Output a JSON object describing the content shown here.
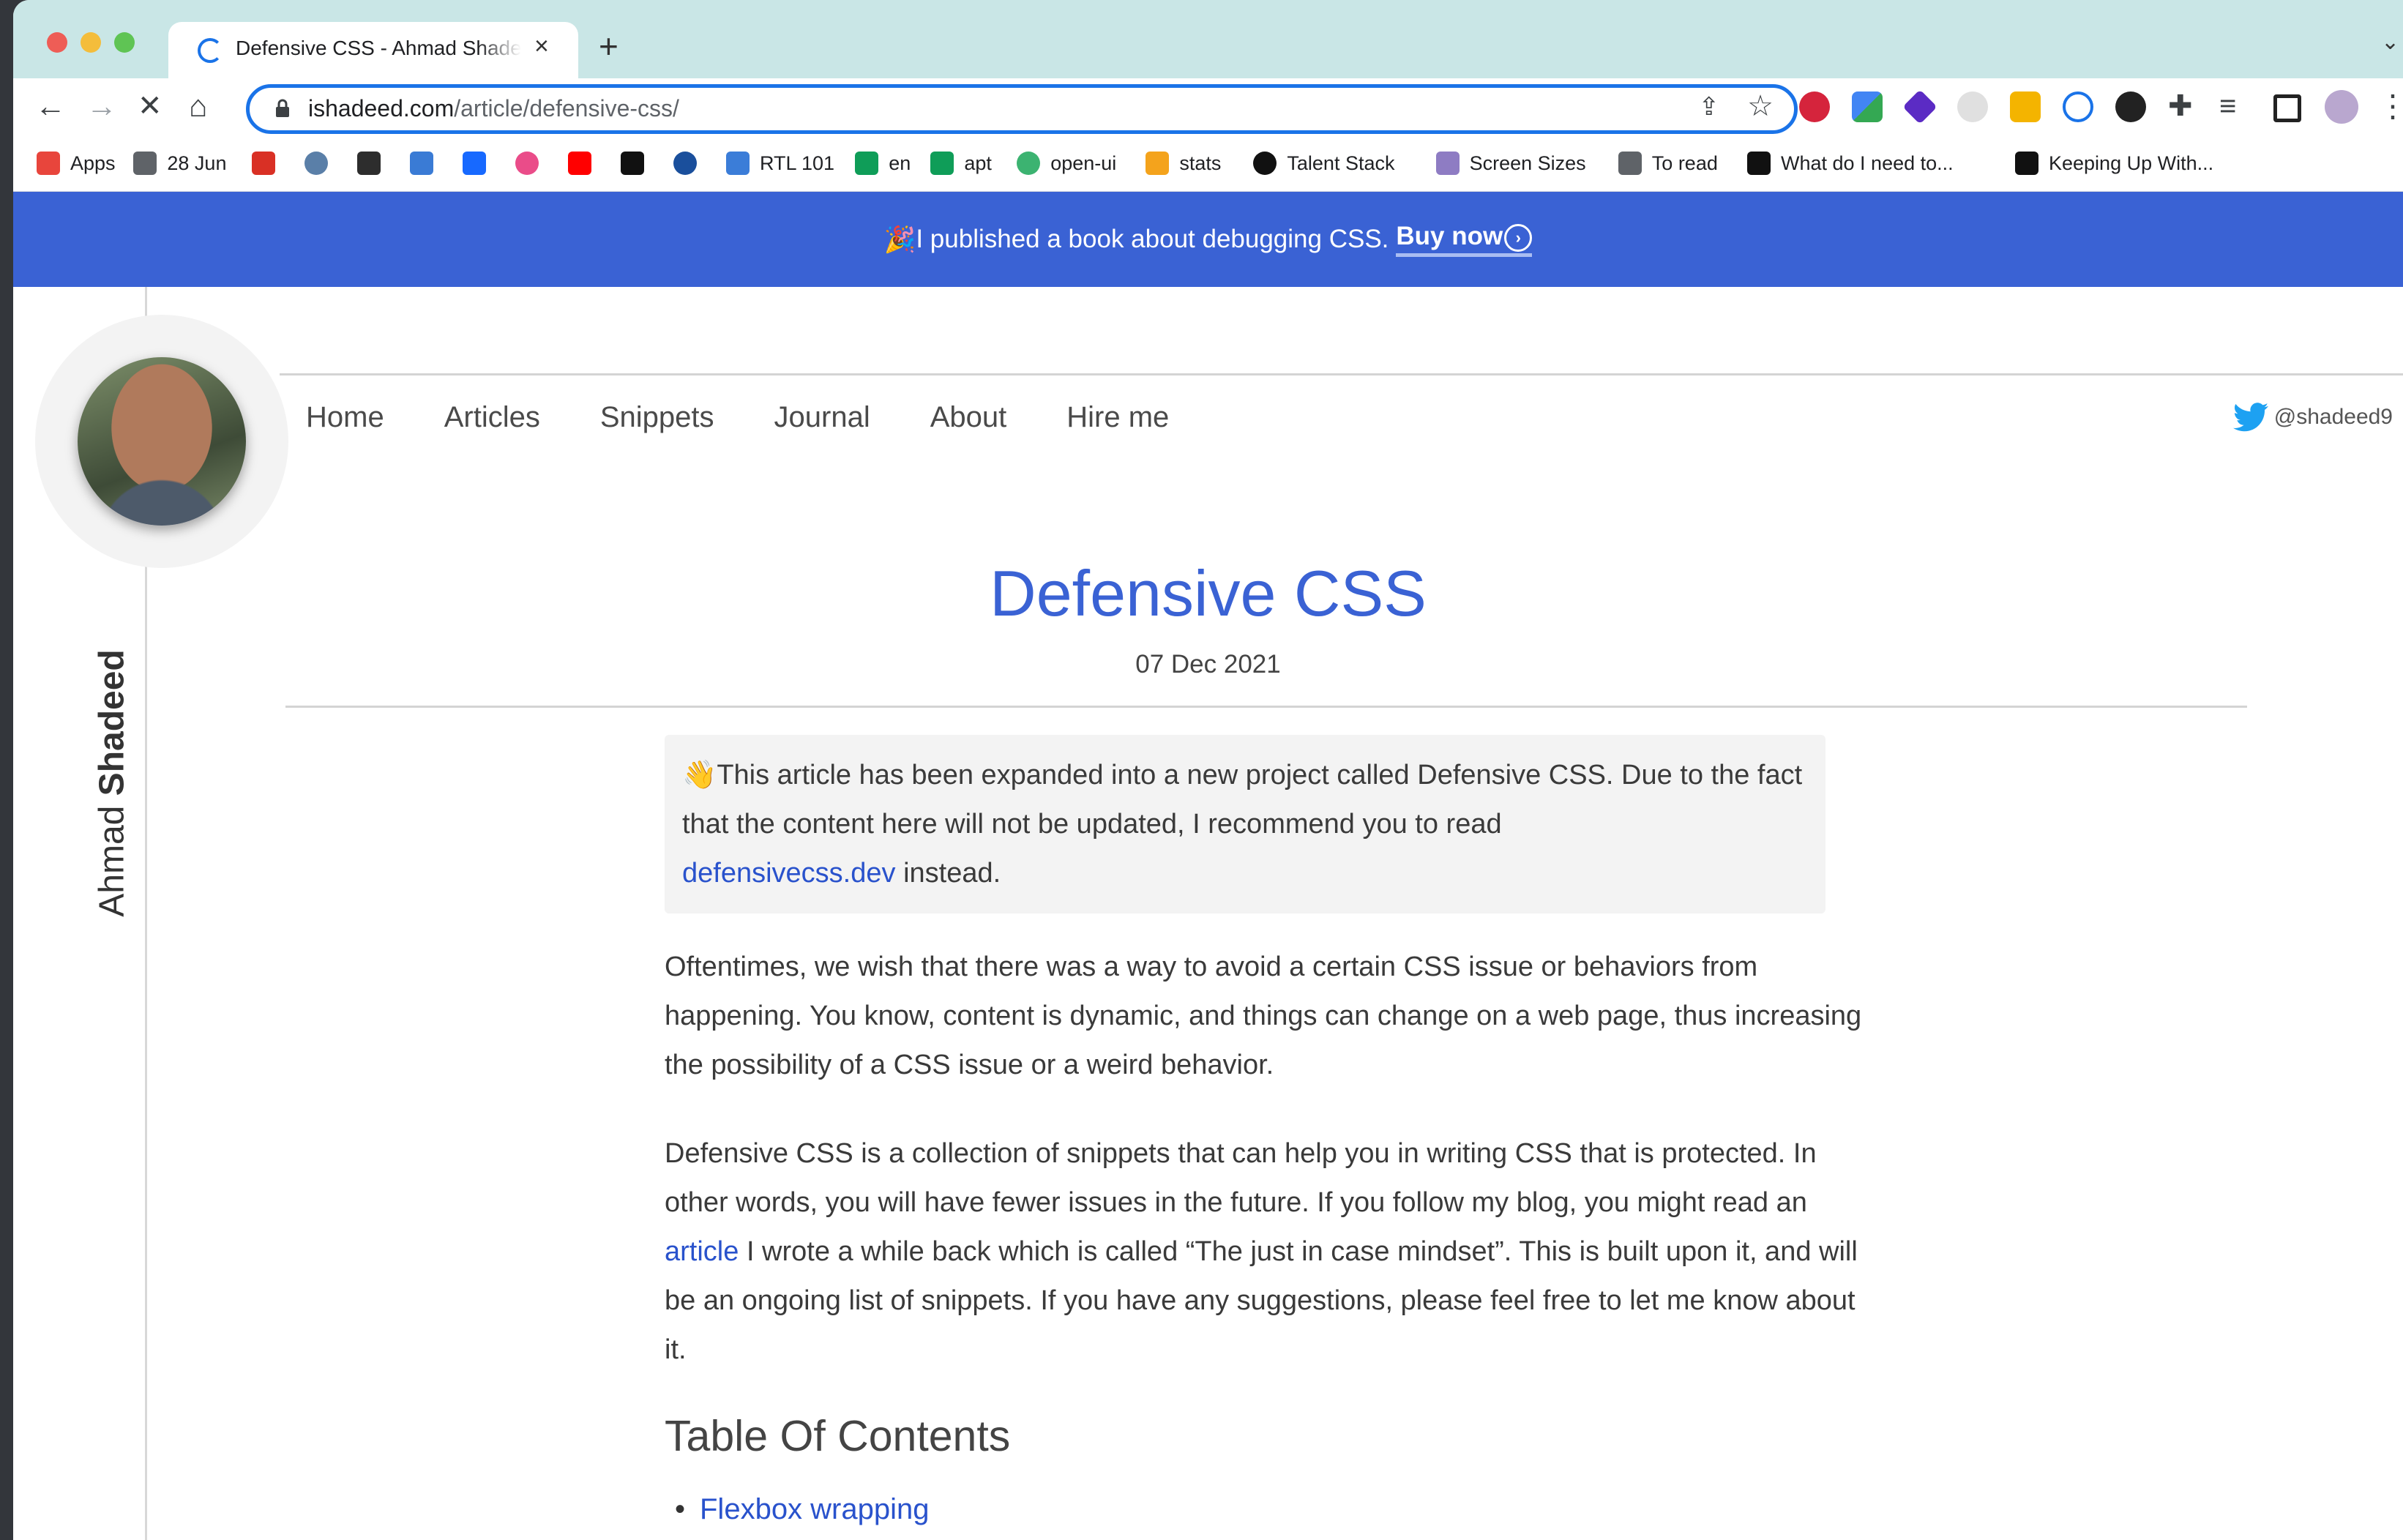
{
  "browser": {
    "tab_title": "Defensive CSS - Ahmad Shadeed",
    "new_tab": "+",
    "url_domain": "ishadeed.com",
    "url_path": "/article/defensive-css/"
  },
  "bookmarks": [
    {
      "label": "Apps",
      "icon": "apps-grid-icon",
      "color": "#e8453c"
    },
    {
      "label": "28 Jun",
      "icon": "folder-icon",
      "color": "#5f6368"
    },
    {
      "label": "",
      "icon": "gmail-icon",
      "color": "#d93025"
    },
    {
      "label": "",
      "icon": "globe-icon",
      "color": "#5a7fa8"
    },
    {
      "label": "",
      "icon": "shield-icon",
      "color": "#2d2d2d"
    },
    {
      "label": "",
      "icon": "bookmark-blue-icon",
      "color": "#3a7bd5"
    },
    {
      "label": "",
      "icon": "behance-icon",
      "color": "#1769ff"
    },
    {
      "label": "",
      "icon": "dribbble-icon",
      "color": "#ea4c89"
    },
    {
      "label": "",
      "icon": "youtube-icon",
      "color": "#ff0000"
    },
    {
      "label": "",
      "icon": "codepen-icon",
      "color": "#111111"
    },
    {
      "label": "",
      "icon": "info-icon",
      "color": "#1a4f9c"
    },
    {
      "label": "RTL 101",
      "icon": "chat-icon",
      "color": "#3b7dd8"
    },
    {
      "label": "en",
      "icon": "sheets-icon",
      "color": "#0f9d58"
    },
    {
      "label": "apt",
      "icon": "sheets-icon",
      "color": "#0f9d58"
    },
    {
      "label": "open-ui",
      "icon": "open-ui-icon",
      "color": "#3cb371"
    },
    {
      "label": "stats",
      "icon": "bar-chart-icon",
      "color": "#f4a31c"
    },
    {
      "label": "Talent Stack",
      "icon": "talent-stack-icon",
      "color": "#111111"
    },
    {
      "label": "Screen Sizes",
      "icon": "screen-sizes-icon",
      "color": "#8e7cc3"
    },
    {
      "label": "To read",
      "icon": "folder-icon",
      "color": "#5f6368"
    },
    {
      "label": "What do I need to...",
      "icon": "arrow-logo-icon",
      "color": "#111111"
    },
    {
      "label": "Keeping Up With...",
      "icon": "dev-icon",
      "color": "#111111"
    }
  ],
  "banner": {
    "text": "I published a book about debugging CSS.",
    "emoji": "🎉",
    "cta": "Buy now",
    "cta_icon": "›"
  },
  "sidebar": {
    "first_name": "Ahmad",
    "last_name": "Shadeed"
  },
  "nav": {
    "items": [
      "Home",
      "Articles",
      "Snippets",
      "Journal",
      "About",
      "Hire me"
    ],
    "twitter_handle": "@shadeed9"
  },
  "article": {
    "title": "Defensive CSS",
    "date": "07 Dec 2021",
    "note_emoji": "👋",
    "note_text": "This article has been expanded into a new project called Defensive CSS. Due to the fact that the content here will not be updated, I recommend you to read",
    "note_link": "defensivecss.dev",
    "note_after": "instead.",
    "p1": "Oftentimes, we wish that there was a way to avoid a certain CSS issue or behaviors from happening. You know, content is dynamic, and things can change on a web page, thus increasing the possibility of a CSS issue or a weird behavior.",
    "p2_before": "Defensive CSS is a collection of snippets that can help you in writing CSS that is protected. In other words, you will have fewer issues in the future. If you follow my blog, you might read an",
    "p2_link": "article",
    "p2_after": "I wrote a while back which is called “The just in case mindset”. This is built upon it, and will be an ongoing list of snippets. If you have any suggestions, please feel free to let me know about it.",
    "toc_heading": "Table Of Contents",
    "toc_items": [
      "Flexbox wrapping"
    ]
  },
  "colors": {
    "accent": "#3a62d4",
    "link": "#2952cc",
    "tab_strip": "#c9e6e6"
  }
}
